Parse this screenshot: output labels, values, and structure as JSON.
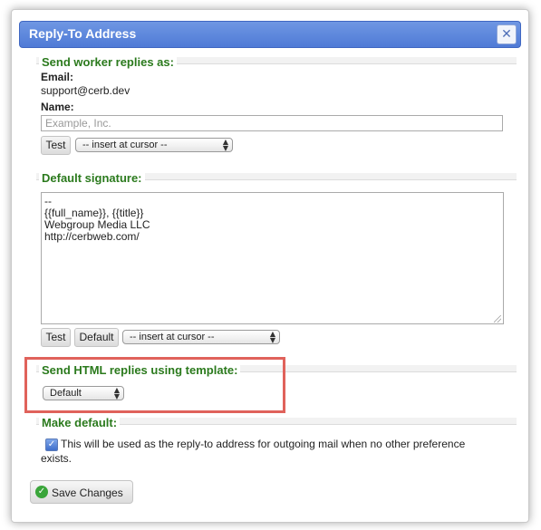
{
  "dialog": {
    "title": "Reply-To Address",
    "close_icon": "close-icon"
  },
  "worker_replies": {
    "section_label": "Send worker replies as:",
    "email_label": "Email:",
    "email_value": "support@cerb.dev",
    "name_label": "Name:",
    "name_placeholder": "Example, Inc.",
    "name_value": "",
    "test_button": "Test",
    "insert_select": "-- insert at cursor --"
  },
  "signature": {
    "section_label": "Default signature:",
    "text": "--\n{{full_name}}, {{title}}\nWebgroup Media LLC\nhttp://cerbweb.com/",
    "test_button": "Test",
    "default_button": "Default",
    "insert_select": "-- insert at cursor --"
  },
  "html_template": {
    "section_label": "Send HTML replies using template:",
    "selected": "Default"
  },
  "make_default": {
    "section_label": "Make default:",
    "checked": true,
    "checkbox_text": "This will be used as the reply-to address for outgoing mail when no other preference exists."
  },
  "footer": {
    "save_button": "Save Changes",
    "save_icon": "ok-circle-icon"
  },
  "colors": {
    "titlebar": "#5a84db",
    "section_label": "#2b7a1d",
    "highlight": "#e0625b"
  }
}
